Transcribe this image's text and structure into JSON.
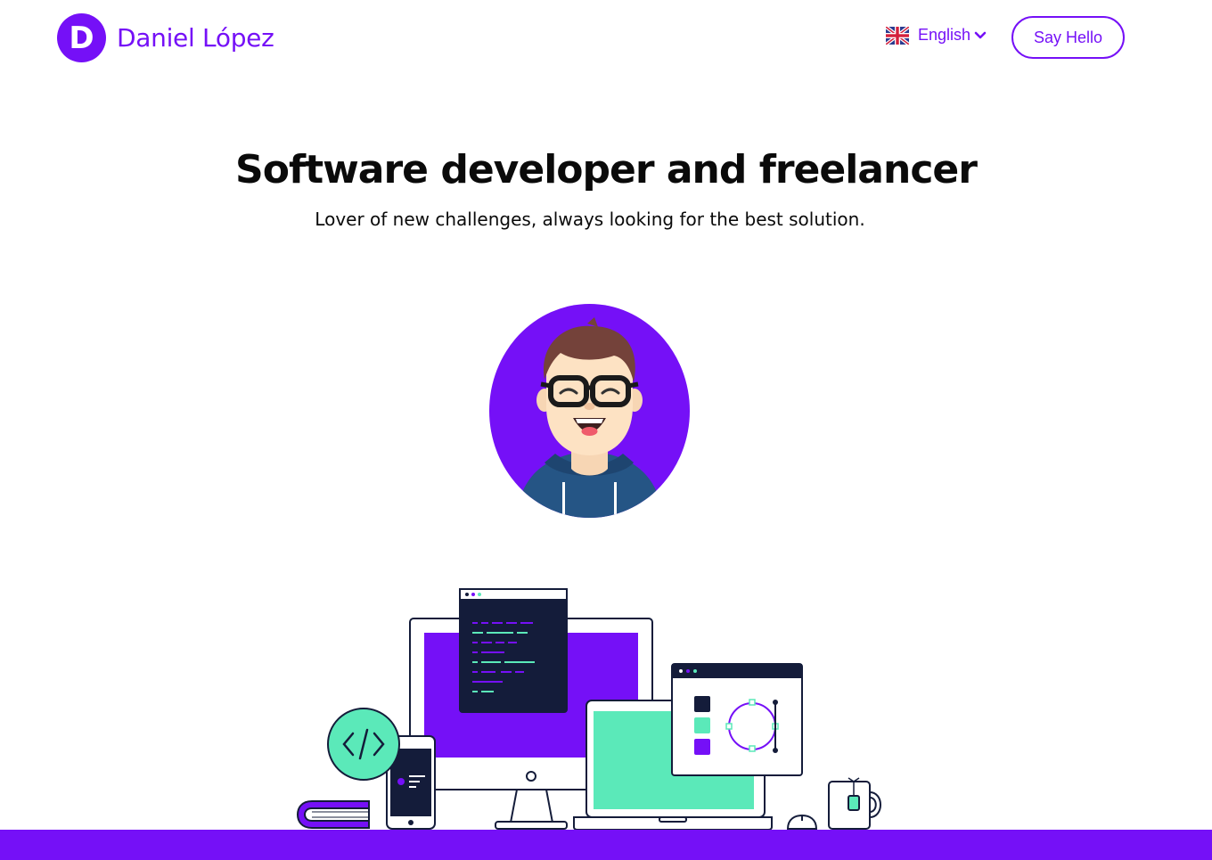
{
  "brand": {
    "initial": "D",
    "name": "Daniel López",
    "accent_color": "#7510f7",
    "secondary_color": "#5be9b9",
    "dark_color": "#141c3a"
  },
  "header": {
    "language": {
      "flag_icon": "uk-flag-icon",
      "label": "English",
      "dropdown_icon": "chevron-down-icon"
    },
    "cta_label": "Say Hello"
  },
  "hero": {
    "title": "Software developer and freelancer",
    "subtitle": "Lover of new challenges, always looking for the best solution."
  },
  "illustrations": {
    "avatar": "developer-avatar-illustration",
    "devices": "devices-workspace-illustration"
  }
}
